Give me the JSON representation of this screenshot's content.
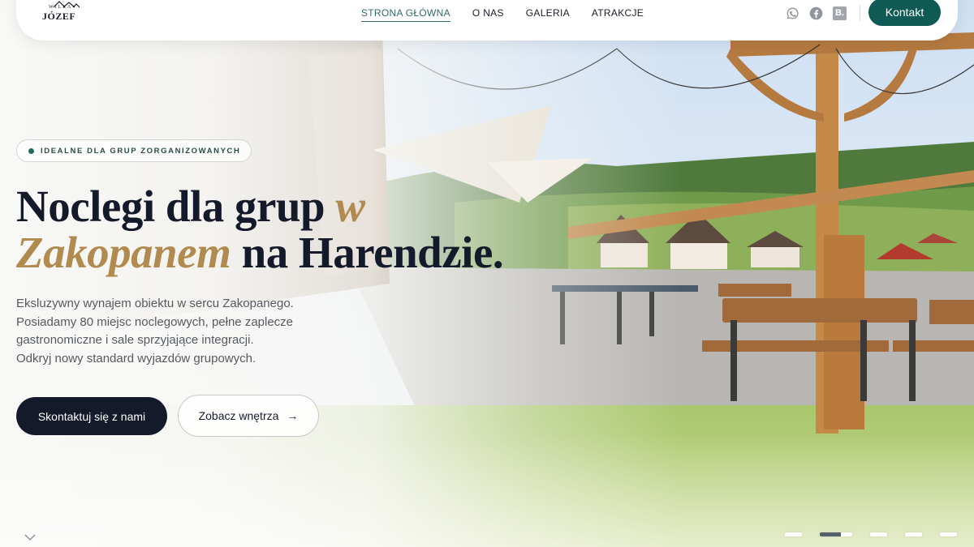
{
  "logo": {
    "small": "WILLA",
    "main": "JÓZEF"
  },
  "nav": {
    "links": [
      "STRONA GŁÓWNA",
      "O NAS",
      "GALERIA",
      "ATRAKCJE"
    ],
    "active_index": 0,
    "contact_button": "Kontakt"
  },
  "socials": [
    "whatsapp-icon",
    "facebook-icon",
    "booking-icon"
  ],
  "booking_letter": "B.",
  "hero": {
    "badge": "IDEALNE DLA GRUP ZORGANIZOWANYCH",
    "headline": {
      "part1": "Noclegi dla grup ",
      "italic1": "w",
      "italic2": "Zakopanem",
      "part2": " na Harendzie."
    },
    "description": [
      "Eksluzywny wynajem obiektu w sercu Zakopanego.",
      "Posiadamy 80 miejsc noclegowych, pełne zaplecze",
      "gastronomiczne i sale sprzyjające integracji.",
      "Odkryj nowy standard wyjazdów grupowych."
    ],
    "primary_button": "Skontaktuj się z nami",
    "secondary_button": "Zobacz wnętrza",
    "secondary_arrow": "→"
  },
  "slider": {
    "count": 5,
    "active_index": 1
  },
  "colors": {
    "brand_green": "#0f5a55",
    "accent_gold": "#b08a4e",
    "dark_navy": "#141a2a",
    "active_link": "#2f6b66"
  }
}
